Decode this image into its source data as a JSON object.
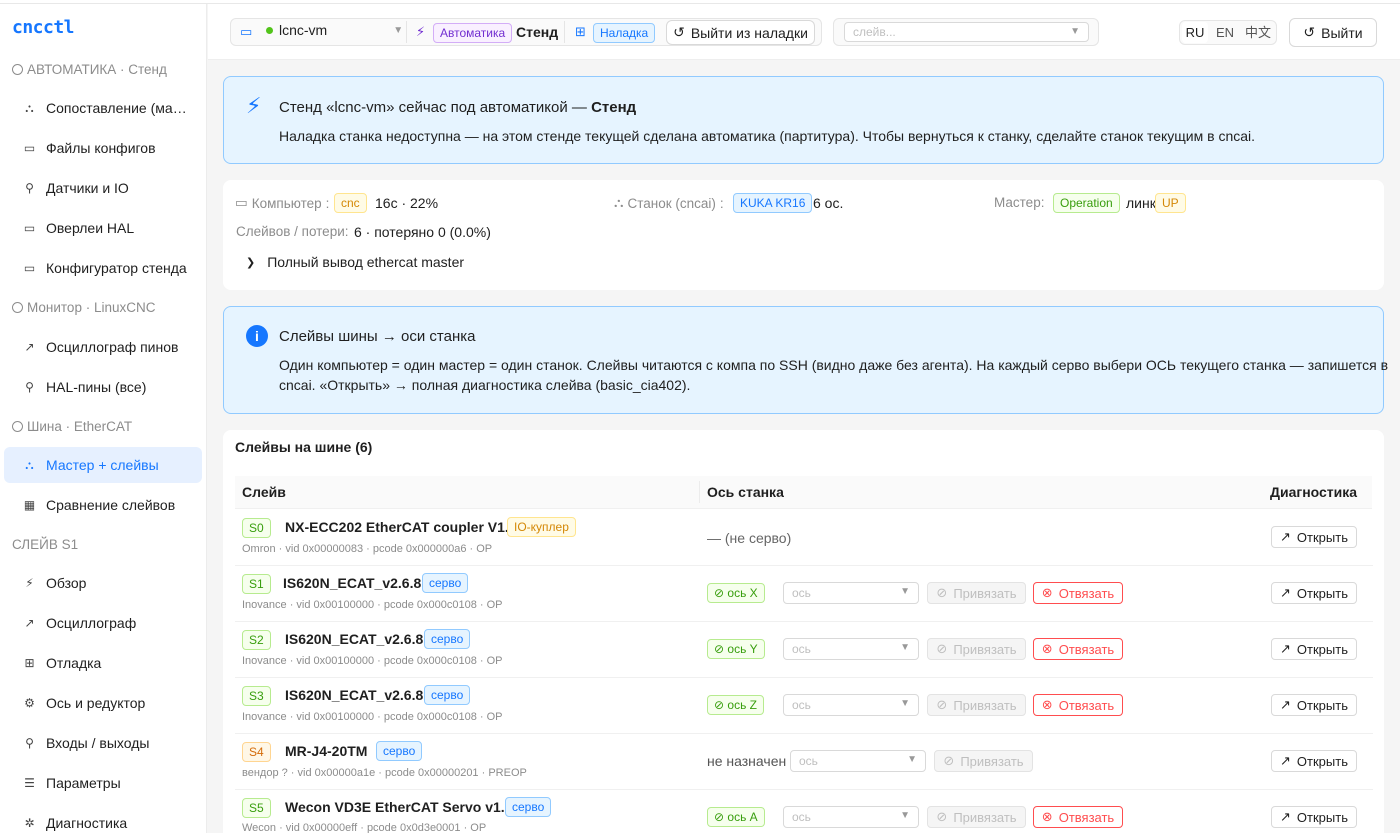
{
  "app": {
    "title": "cncctl"
  },
  "sidebar": {
    "groups": [
      {
        "label": "АВТОМАТИКА · Стенд"
      },
      {
        "label": "Монитор · LinuxCNC"
      },
      {
        "label": "Шина · EtherCAT"
      },
      {
        "label": "СЛЕЙВ S1"
      }
    ],
    "items": [
      {
        "label": "Сопоставление (маппинг)",
        "icon": "mapping-icon"
      },
      {
        "label": "Файлы конфигов",
        "icon": "folder-icon"
      },
      {
        "label": "Датчики и IO",
        "icon": "plug-icon"
      },
      {
        "label": "Оверлеи HAL",
        "icon": "folder-icon"
      },
      {
        "label": "Конфигуратор стенда",
        "icon": "monitor-icon"
      },
      {
        "label": "Осциллограф пинов",
        "icon": "chart-icon"
      },
      {
        "label": "HAL-пины (все)",
        "icon": "plug-icon"
      },
      {
        "label": "Мастер + слейвы",
        "icon": "mapping-icon"
      },
      {
        "label": "Сравнение слейвов",
        "icon": "table-icon"
      },
      {
        "label": "Обзор",
        "icon": "bolt-icon"
      },
      {
        "label": "Осциллограф",
        "icon": "chart-icon"
      },
      {
        "label": "Отладка",
        "icon": "debug-icon"
      },
      {
        "label": "Ось и редуктор",
        "icon": "gear-icon"
      },
      {
        "label": "Входы / выходы",
        "icon": "plug-icon"
      },
      {
        "label": "Параметры",
        "icon": "list-icon"
      },
      {
        "label": "Диагностика",
        "icon": "bug-icon"
      }
    ]
  },
  "topbar": {
    "vm": "lcnc-vm",
    "tag_automation": "Автоматика",
    "stand": "Стенд",
    "tag_setup": "Наладка",
    "exit_setup": "Выйти из наладки",
    "slave_placeholder": "слейв...",
    "langs": [
      "RU",
      "EN",
      "中文"
    ],
    "logout": "Выйти"
  },
  "alert": {
    "title_prefix": "Стенд «lcnc-vm» сейчас под автоматикой — ",
    "title_bold": "Стенд",
    "text": "Наладка станка недоступна — на этом стенде текущей сделана автоматика (партитура). Чтобы вернуться к станку, сделайте станок текущим в cncai."
  },
  "status": {
    "computer_label": "Компьютер",
    "computer_tag": "cnc",
    "computer_value": "16с · 22%",
    "machine_label": "Станок (cncai)",
    "machine_tag": "KUKA KR16",
    "machine_value": "6 ос.",
    "master_label": "Мастер",
    "master_tag": "Operation",
    "link_label": "линк",
    "link_tag": "UP",
    "slaves_label": "Слейвов / потери",
    "slaves_value": "6 · потеряно 0 (0.0%)",
    "expand_label": "Полный вывод ethercat master"
  },
  "info": {
    "title": "Слейвы шины → оси станка",
    "text_line1": "Один компьютер = один мастер = один станок. Слейвы читаются с компа по SSH (видно даже без агента). На каждый серво выбери ОСЬ текущего станка — запишется в",
    "text_line2": "cncai. «Открыть» → полная диагностика слейва (basic_cia402)."
  },
  "table": {
    "title": "Слейвы на шине (6)",
    "col_slave": "Слейв",
    "col_axis": "Ось станка",
    "col_diag": "Диагностика",
    "axis_placeholder": "ось",
    "bind_label": "Привязать",
    "unbind_label": "Отвязать",
    "open_label": "Открыть",
    "rows": [
      {
        "id": "S0",
        "name": "NX-ECC202 EtherCAT coupler V1.2",
        "type": "IO-куплер",
        "meta": "Omron · vid 0x00000083 · pcode 0x000000a6 · OP",
        "axis": "— (не серво)"
      },
      {
        "id": "S1",
        "name": "IS620N_ECAT_v2.6.8",
        "type": "серво",
        "meta": "Inovance · vid 0x00100000 · pcode 0x000c0108 · OP",
        "axis": "ось X"
      },
      {
        "id": "S2",
        "name": "IS620N_ECAT_v2.6.8",
        "type": "серво",
        "meta": "Inovance · vid 0x00100000 · pcode 0x000c0108 · OP",
        "axis": "ось Y"
      },
      {
        "id": "S3",
        "name": "IS620N_ECAT_v2.6.8",
        "type": "серво",
        "meta": "Inovance · vid 0x00100000 · pcode 0x000c0108 · OP",
        "axis": "ось Z"
      },
      {
        "id": "S4",
        "name": "MR-J4-20TM",
        "type": "серво",
        "meta": "вендор ? · vid 0x00000a1e · pcode 0x00000201 · PREOP",
        "axis": "не назначен"
      },
      {
        "id": "S5",
        "name": "Wecon VD3E EtherCAT Servo v1.15",
        "type": "серво",
        "meta": "Wecon · vid 0x00000eff · pcode 0x0d3e0001 · OP",
        "axis": "ось A"
      }
    ]
  }
}
